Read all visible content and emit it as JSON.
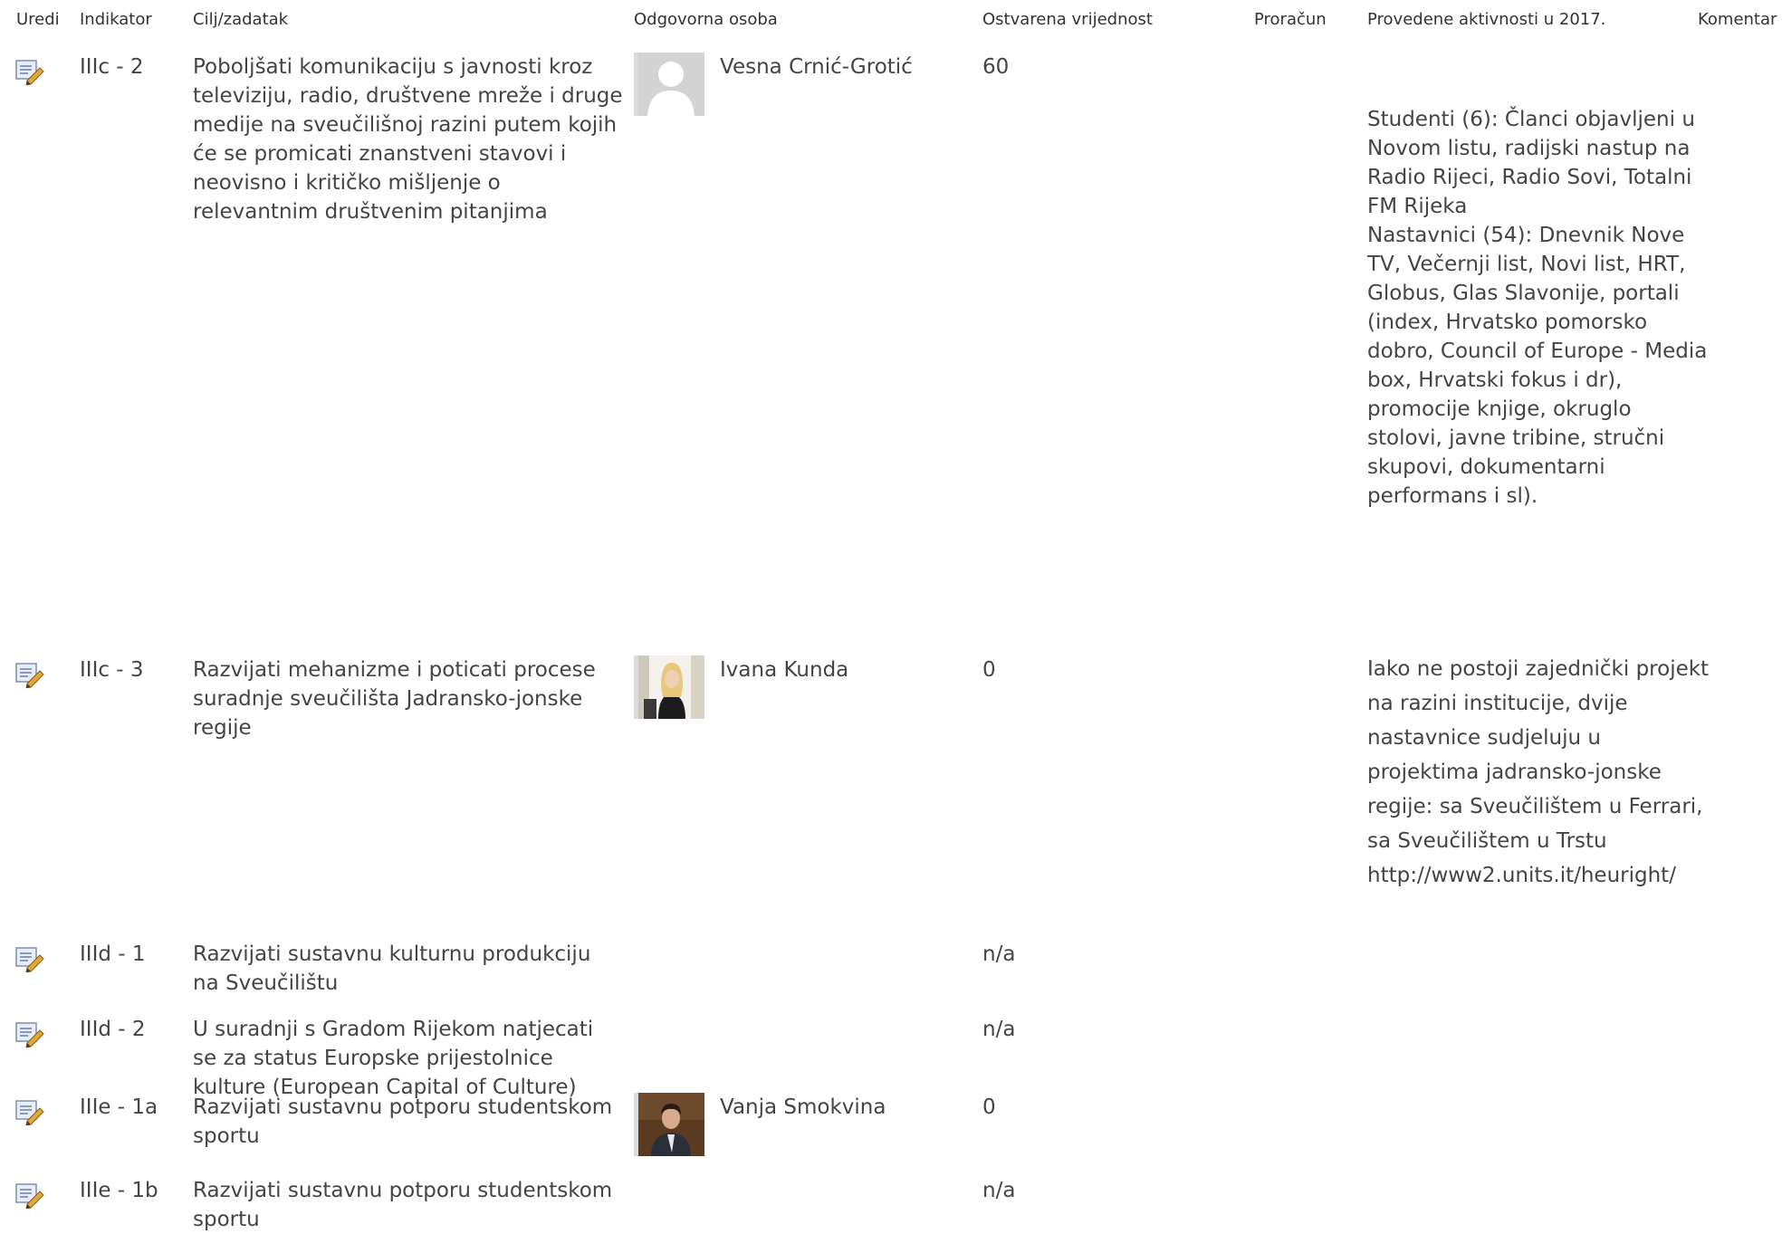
{
  "headers": {
    "edit": "Uredi",
    "indicator": "Indikator",
    "goal": "Cilj/zadatak",
    "responsible": "Odgovorna osoba",
    "achieved": "Ostvarena vrijednost",
    "budget": "Proračun",
    "activities": "Provedene aktivnosti u 2017.",
    "comment": "Komentar"
  },
  "rows": [
    {
      "indicator": "IIIc - 2",
      "goal": "Poboljšati komunikaciju s javnosti kroz televiziju, radio, društvene mreže i druge medije na sveučilišnoj razini putem kojih će se promicati znanstveni stavovi i neovisno i kritičko mišljenje o relevantnim društvenim pitanjima",
      "person": "Vesna Crnić-Grotić",
      "avatar": "default-avatar-icon",
      "achieved": "60",
      "activities": "Studenti (6): Članci objavljeni u Novom listu, radijski nastup na Radio Rijeci, Radio Sovi, Totalni FM Rijeka\nNastavnici (54): Dnevnik Nove TV, Večernji list, Novi list, HRT, Globus, Glas Slavonije, portali (index, Hrvatsko pomorsko dobro, Council of Europe - Media box, Hrvatski fokus i dr), promocije knjige, okruglo stolovi, javne tribine, stručni skupovi, dokumentarni performans i sl)."
    },
    {
      "indicator": "IIIc - 3",
      "goal": "Razvijati mehanizme i poticati procese suradnje sveučilišta Jadransko-jonske regije",
      "person": "Ivana Kunda",
      "avatar": "photo-woman-blonde",
      "achieved": "0",
      "activities": "Iako ne postoji zajednički projekt na razini institucije, dvije nastavnice sudjeluju u projektima jadransko-jonske regije: sa Sveučilištem u Ferrari, sa Sveučilištem u Trstu http://www2.units.it/heuright/"
    },
    {
      "indicator": "IIId - 1",
      "goal": "Razvijati sustavnu kulturnu produkciju na Sveučilištu",
      "achieved": "n/a"
    },
    {
      "indicator": "IIId - 2",
      "goal": "U suradnji s Gradom Rijekom natjecati se za status Europske prijestolnice kulture (European Capital of Culture)",
      "achieved": "n/a"
    },
    {
      "indicator": "IIIe - 1a",
      "goal": "Razvijati sustavnu potporu studentskom sportu",
      "person": "Vanja Smokvina",
      "avatar": "photo-man-suit",
      "achieved": "0"
    },
    {
      "indicator": "IIIe - 1b",
      "goal": "Razvijati sustavnu potporu studentskom sportu",
      "achieved": "n/a"
    }
  ],
  "edit_icon": "edit-item-icon"
}
